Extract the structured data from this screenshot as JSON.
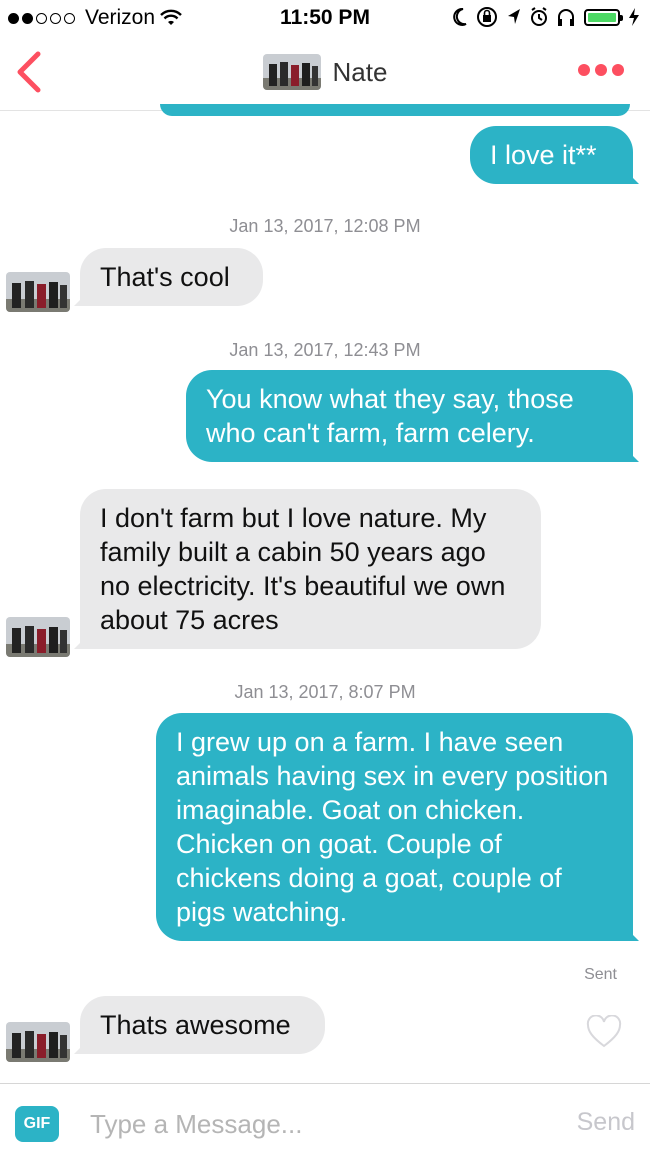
{
  "status_bar": {
    "carrier": "Verizon",
    "signal_dots": [
      true,
      true,
      false,
      false,
      false
    ],
    "time": "11:50 PM",
    "battery_color": "#4cd964",
    "icons": [
      "wifi-icon",
      "moon-icon",
      "rotation-lock-icon",
      "location-arrow-icon",
      "alarm-icon",
      "headphones-icon",
      "battery-icon",
      "charging-bolt-icon"
    ]
  },
  "header": {
    "contact_name": "Nate",
    "accent_color": "#fd4f60"
  },
  "messages": [
    {
      "direction": "out",
      "text": "I love it**"
    },
    {
      "timestamp": "Jan 13, 2017, 12:08 PM"
    },
    {
      "direction": "in",
      "text": "That's cool"
    },
    {
      "timestamp": "Jan 13, 2017, 12:43 PM"
    },
    {
      "direction": "out",
      "text": "You know what they say, those who can't farm, farm celery."
    },
    {
      "direction": "in",
      "text": "I don't farm but I love nature. My family built a cabin 50 years ago no electricity. It's beautiful we own about 75 acres"
    },
    {
      "timestamp": "Jan 13, 2017, 8:07 PM"
    },
    {
      "direction": "out",
      "text": "I grew up on a farm. I have seen animals having sex in every position imaginable. Goat on chicken. Chicken on goat. Couple of chickens doing a goat, couple of pigs watching."
    },
    {
      "status": "Sent"
    },
    {
      "direction": "in",
      "text": "Thats awesome"
    }
  ],
  "bubble_colors": {
    "outgoing": "#2cb3c6",
    "incoming": "#e9e9ea"
  },
  "composer": {
    "gif_label": "GIF",
    "placeholder": "Type a Message...",
    "value": "",
    "send_label": "Send"
  }
}
